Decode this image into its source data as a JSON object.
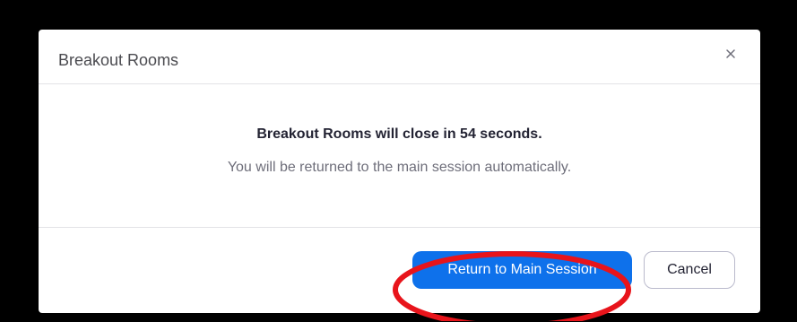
{
  "dialog": {
    "title": "Breakout Rooms",
    "close_icon": "close-icon",
    "headline": "Breakout Rooms will close in 54 seconds.",
    "message": "You will be returned to the main session automatically.",
    "primary_button_label": "Return to Main Session",
    "secondary_button_label": "Cancel"
  },
  "colors": {
    "primary": "#0e71eb",
    "annotation": "#e8141b",
    "backdrop": "#000000"
  }
}
